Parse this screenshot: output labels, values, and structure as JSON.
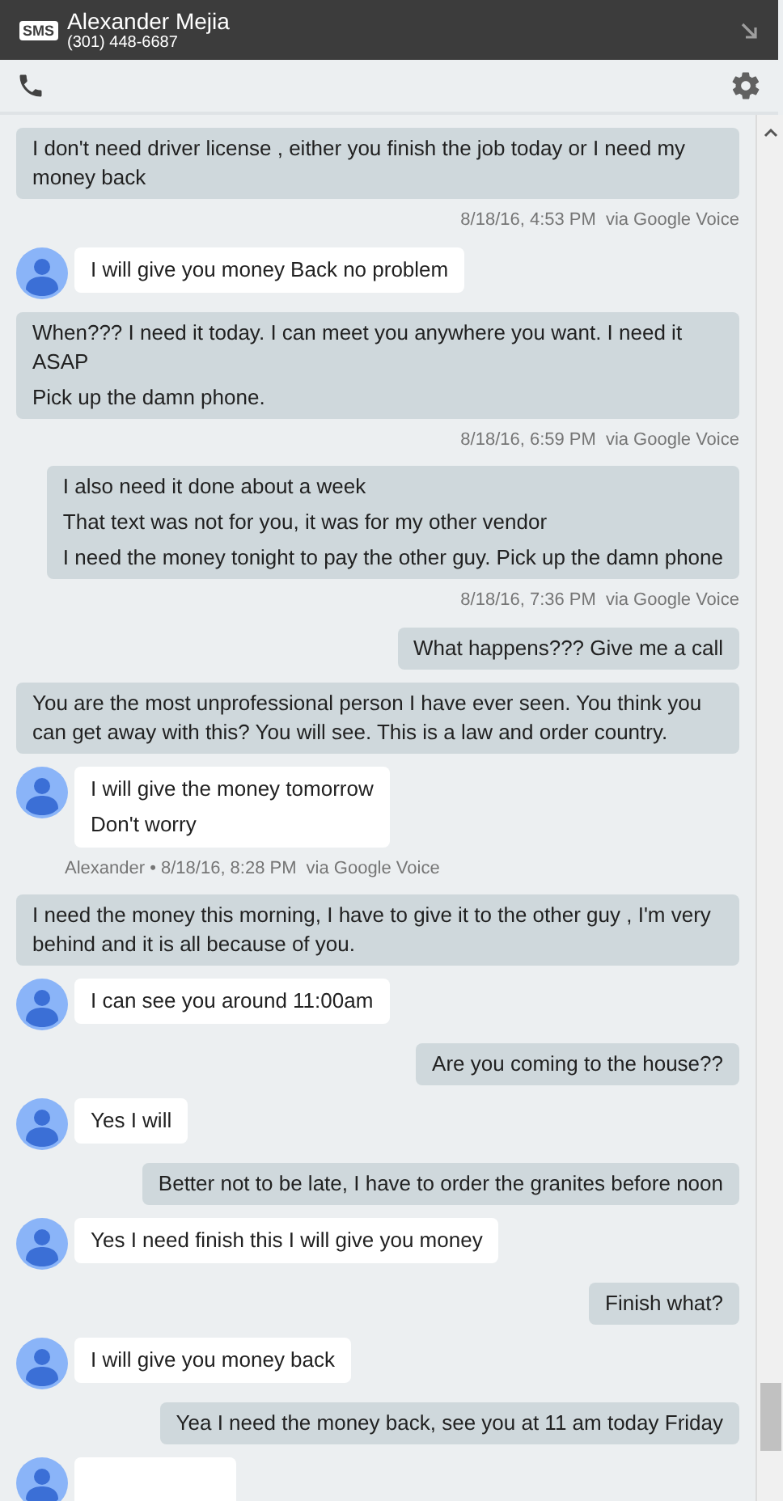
{
  "header": {
    "badge": "SMS",
    "name": "Alexander Mejia",
    "phone": "(301) 448-6687"
  },
  "messages": [
    {
      "kind": "outgoing",
      "lines": [
        "I don't need driver license , either you finish the job today or I need my money back"
      ]
    },
    {
      "kind": "meta_out",
      "text": "8/18/16, 4:53 PM",
      "via": "via Google Voice"
    },
    {
      "kind": "incoming",
      "lines": [
        "I will give you money Back no problem"
      ]
    },
    {
      "kind": "outgoing",
      "lines": [
        "When??? I need it today. I can meet you anywhere you want. I need it ASAP",
        "Pick up the damn phone."
      ]
    },
    {
      "kind": "meta_out",
      "text": "8/18/16, 6:59 PM",
      "via": "via Google Voice"
    },
    {
      "kind": "outgoing",
      "lines": [
        "I also need it done about a week",
        "That text was not for you, it was for my other vendor",
        "I need the money tonight to pay the other guy. Pick up the damn phone"
      ]
    },
    {
      "kind": "meta_out",
      "text": "8/18/16, 7:36 PM",
      "via": "via Google Voice"
    },
    {
      "kind": "outgoing",
      "lines": [
        "What happens??? Give me a call"
      ]
    },
    {
      "kind": "outgoing",
      "lines": [
        "You are the most unprofessional person I have ever seen. You think you can get away with this? You will see. This is a law and order country."
      ]
    },
    {
      "kind": "incoming",
      "lines": [
        "I will give the money tomorrow",
        "Don't worry"
      ]
    },
    {
      "kind": "meta_in",
      "text": "Alexander • 8/18/16, 8:28 PM",
      "via": "via Google Voice"
    },
    {
      "kind": "outgoing",
      "lines": [
        "I need the money this morning, I have to give it to the other guy , I'm very behind and it is all because of you."
      ]
    },
    {
      "kind": "incoming",
      "lines": [
        "I can see you around 11:00am"
      ]
    },
    {
      "kind": "outgoing",
      "lines": [
        "Are you coming to the house??"
      ]
    },
    {
      "kind": "incoming",
      "lines": [
        "Yes I will"
      ]
    },
    {
      "kind": "outgoing",
      "lines": [
        "Better not to be late, I have to order the granites before noon"
      ]
    },
    {
      "kind": "incoming",
      "lines": [
        "Yes I need finish this I will give you money"
      ]
    },
    {
      "kind": "outgoing",
      "lines": [
        "Finish what?"
      ]
    },
    {
      "kind": "incoming",
      "lines": [
        "I will give you money back"
      ]
    },
    {
      "kind": "outgoing",
      "lines": [
        "Yea I need the money back, see you at 11 am today Friday"
      ]
    },
    {
      "kind": "incoming"
    }
  ]
}
